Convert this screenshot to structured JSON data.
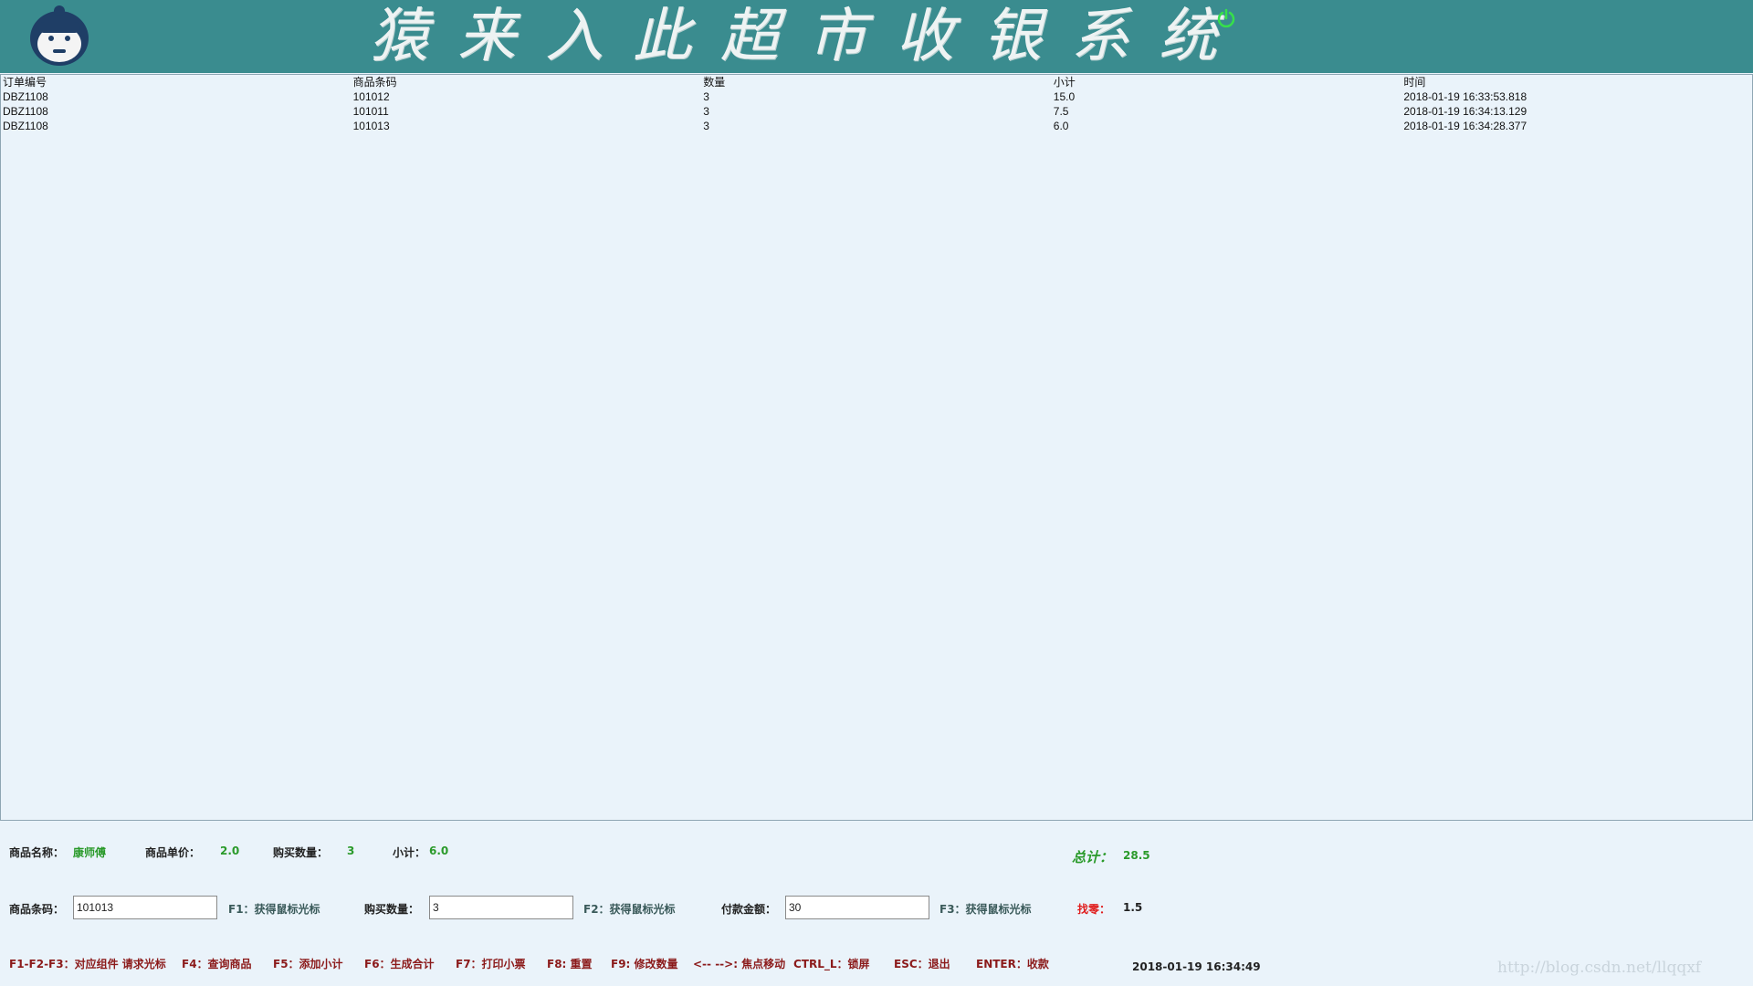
{
  "header": {
    "title": "猿来入此超市收银系统",
    "logo_icon": "monkey-logo-icon",
    "power_icon": "power-icon",
    "bg_color": "#3a8c8f"
  },
  "table": {
    "columns": [
      "订单编号",
      "商品条码",
      "数量",
      "小计",
      "时间"
    ],
    "rows": [
      [
        "DBZ1108",
        "101012",
        "3",
        "15.0",
        "2018-01-19 16:33:53.818"
      ],
      [
        "DBZ1108",
        "101011",
        "3",
        "7.5",
        "2018-01-19 16:34:13.129"
      ],
      [
        "DBZ1108",
        "101013",
        "3",
        "6.0",
        "2018-01-19 16:34:28.377"
      ]
    ]
  },
  "info": {
    "product_name_label": "商品名称：",
    "product_name_value": "康师傅",
    "unit_price_label": "商品单价：",
    "unit_price_value": "2.0",
    "quantity_label": "购买数量：",
    "quantity_value": "3",
    "subtotal_label": "小计：",
    "subtotal_value": "6.0",
    "total_label": "总计：",
    "total_value": "28.5"
  },
  "form": {
    "barcode_label": "商品条码：",
    "barcode_value": "101013",
    "barcode_hint": "F1：获得鼠标光标",
    "qty_label": "购买数量：",
    "qty_value": "3",
    "qty_hint": "F2：获得鼠标光标",
    "pay_label": "付款金额：",
    "pay_value": "30",
    "pay_hint": "F3：获得鼠标光标",
    "change_label": "找零：",
    "change_value": "1.5"
  },
  "shortcuts": [
    "F1-F2-F3：对应组件 请求光标",
    "F4：查询商品",
    "F5：添加小计",
    "F6：生成合计",
    "F7：打印小票",
    "F8: 重置",
    "F9: 修改数量",
    "<-- -->: 焦点移动",
    "CTRL_L：锁屏",
    "ESC：退出",
    "ENTER：收款"
  ],
  "clock": "2018-01-19 16:34:49",
  "watermark": "http://blog.csdn.net/llqqxf"
}
